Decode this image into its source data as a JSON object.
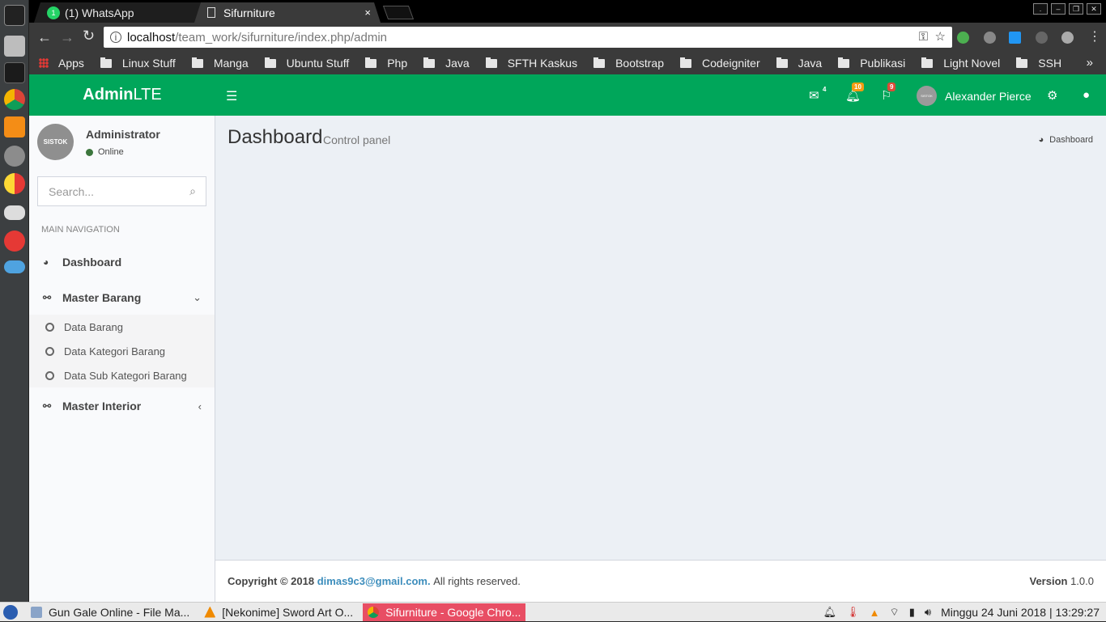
{
  "browser": {
    "tabs": [
      {
        "title": "(1) WhatsApp",
        "close": "×"
      },
      {
        "title": "Sifurniture",
        "close": "×"
      }
    ],
    "url_host": "localhost",
    "url_path": "/team_work/sifurniture/index.php/admin",
    "bookmarks": [
      "Apps",
      "Linux Stuff",
      "Manga",
      "Ubuntu Stuff",
      "Php",
      "Java",
      "SFTH Kaskus",
      "Bootstrap",
      "Codeigniter",
      "Java",
      "Publikasi",
      "Light Novel",
      "SSH"
    ],
    "overflow": "»"
  },
  "header": {
    "logo_bold": "Admin",
    "logo_rest": "LTE",
    "messages_count": "4",
    "notifications_count": "10",
    "tasks_count": "9",
    "user_name": "Alexander Pierce",
    "avatar_text": "SISTOK"
  },
  "sidebar": {
    "avatar_text": "SISTOK",
    "user_name": "Administrator",
    "status": "Online",
    "search_placeholder": "Search...",
    "nav_header": "MAIN NAVIGATION",
    "items": [
      {
        "label": "Dashboard"
      },
      {
        "label": "Master Barang"
      },
      {
        "label": "Master Interior"
      }
    ],
    "submenu": [
      {
        "label": "Data Barang"
      },
      {
        "label": "Data Kategori Barang"
      },
      {
        "label": "Data Sub Kategori Barang"
      }
    ]
  },
  "content": {
    "title": "Dashboard",
    "subtitle": "Control panel",
    "breadcrumb": "Dashboard"
  },
  "footer": {
    "copyright": "Copyright © 2018",
    "email": "dimas9c3@gmail.com.",
    "rights": "All rights reserved.",
    "version_label": "Version",
    "version": "1.0.0"
  },
  "taskbar": {
    "tasks": [
      {
        "label": "Gun Gale Online - File Ma..."
      },
      {
        "label": "[Nekonime] Sword Art O..."
      },
      {
        "label": "Sifurniture - Google Chro..."
      }
    ],
    "clock": "Minggu 24 Juni 2018 | 13:29:27"
  },
  "colors": {
    "header": "#00a65a",
    "link": "#3c8dbc",
    "active_task": "#e84e64"
  }
}
